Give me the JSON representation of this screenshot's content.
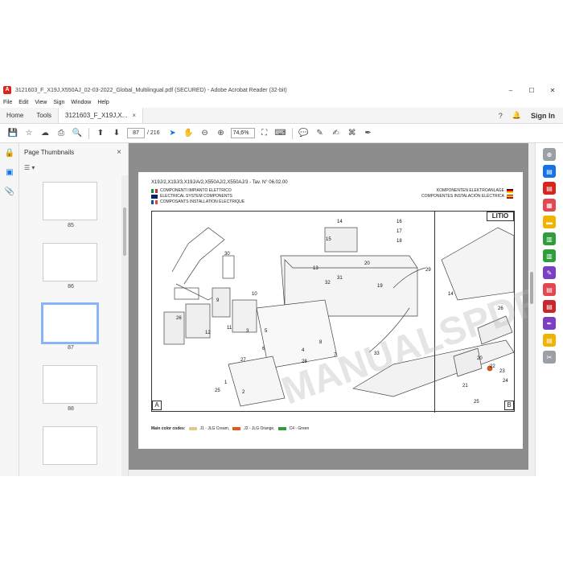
{
  "window": {
    "title": "3121603_F_X19J,X550AJ_02-03-2022_Global_Multilingual.pdf (SECURED) - Adobe Acrobat Reader (32-bit)",
    "min": "–",
    "max": "☐",
    "close": "✕"
  },
  "menu": [
    "File",
    "Edit",
    "View",
    "Sign",
    "Window",
    "Help"
  ],
  "tabs": {
    "home": "Home",
    "tools": "Tools",
    "document": "3121603_F_X19J,X...",
    "close": "×",
    "signin": "Sign In"
  },
  "toolbar": {
    "page_current": "87",
    "page_total": "/ 216",
    "zoom": "74,6%"
  },
  "panel": {
    "title": "Page Thumbnails",
    "close": "×",
    "thumbs": [
      {
        "num": "85"
      },
      {
        "num": "86"
      },
      {
        "num": "87"
      },
      {
        "num": "88"
      }
    ]
  },
  "doc": {
    "header": "X19J/2,X19J/3,X19J/A/2,X550AJ/2,X550AJ/3 - Tav. N° 06.02.00",
    "lang_it": "COMPONENTI IMPIANTO ELETTRICO",
    "lang_en": "ELECTRICAL SYSTEM COMPONENTS",
    "lang_fr": "COMPOSANTS INSTALLATION ÉLECTRIQUE",
    "lang_de": "KOMPONENTEN ELEKTROANLAGE",
    "lang_es": "COMPONENTES INSTALACIÓN ELÉCTRICA",
    "litio": "LITIO",
    "panel_a": "A",
    "panel_b": "B",
    "color_codes_label": "Main color codes:",
    "color_j1": "J1 - JLG Cream,",
    "color_j2": "J2 - JLG Orange,",
    "color_c4": "C4 - Green",
    "watermark": "MANUALSPDF.COM",
    "parts": [
      "14",
      "16",
      "17",
      "18",
      "15",
      "13",
      "20",
      "29",
      "19",
      "31",
      "32",
      "10",
      "9",
      "12",
      "11",
      "3",
      "4",
      "5",
      "7",
      "6",
      "8",
      "27",
      "26",
      "1",
      "25",
      "2",
      "28",
      "33",
      "21",
      "22",
      "23",
      "24",
      "30",
      "14",
      "26",
      "25",
      "20"
    ]
  },
  "colors": {
    "accent": "#1473e6",
    "j1_cream": "#e6c38f",
    "j2_orange": "#e05a1a",
    "c4_green": "#2e9d3a"
  }
}
